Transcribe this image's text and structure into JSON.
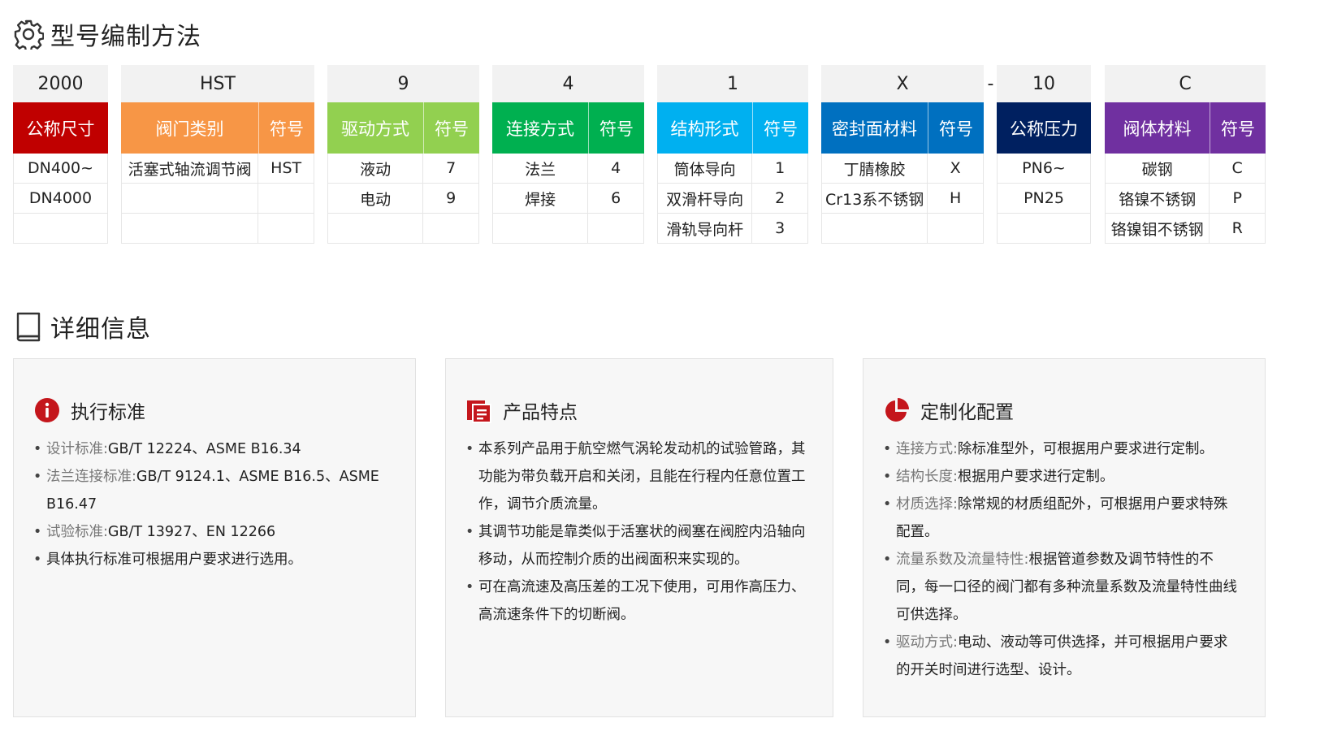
{
  "section1": {
    "title": "型号编制方法",
    "icon": "gear-icon"
  },
  "code_dash": "-",
  "groups": [
    {
      "code": "2000",
      "header": "公称尺寸",
      "header_sym": "",
      "color": "#c00000",
      "rows": [
        {
          "name": "DN400~",
          "sym": ""
        },
        {
          "name": "DN4000",
          "sym": ""
        },
        {
          "name": "",
          "sym": ""
        }
      ]
    },
    {
      "code": "HST",
      "header": "阀门类别",
      "header_sym": "符号",
      "color": "#f79646",
      "rows": [
        {
          "name": "活塞式轴流调节阀",
          "sym": "HST"
        },
        {
          "name": "",
          "sym": ""
        },
        {
          "name": "",
          "sym": ""
        }
      ]
    },
    {
      "code": "9",
      "header": "驱动方式",
      "header_sym": "符号",
      "color": "#92d050",
      "rows": [
        {
          "name": "液动",
          "sym": "7"
        },
        {
          "name": "电动",
          "sym": "9"
        },
        {
          "name": "",
          "sym": ""
        }
      ]
    },
    {
      "code": "4",
      "header": "连接方式",
      "header_sym": "符号",
      "color": "#00b050",
      "rows": [
        {
          "name": "法兰",
          "sym": "4"
        },
        {
          "name": "焊接",
          "sym": "6"
        },
        {
          "name": "",
          "sym": ""
        }
      ]
    },
    {
      "code": "1",
      "header": "结构形式",
      "header_sym": "符号",
      "color": "#00b0f0",
      "rows": [
        {
          "name": "筒体导向",
          "sym": "1"
        },
        {
          "name": "双滑杆导向",
          "sym": "2"
        },
        {
          "name": "滑轨导向杆",
          "sym": "3"
        }
      ]
    },
    {
      "code": "X",
      "header": "密封面材料",
      "header_sym": "符号",
      "color": "#0070c0",
      "rows": [
        {
          "name": "丁腈橡胶",
          "sym": "X"
        },
        {
          "name": "Cr13系不锈钢",
          "sym": "H"
        },
        {
          "name": "",
          "sym": ""
        }
      ]
    },
    {
      "code": "10",
      "header": "公称压力",
      "header_sym": "",
      "color": "#002060",
      "rows": [
        {
          "name": "PN6~",
          "sym": ""
        },
        {
          "name": "PN25",
          "sym": ""
        },
        {
          "name": "",
          "sym": ""
        }
      ]
    },
    {
      "code": "C",
      "header": "阀体材料",
      "header_sym": "符号",
      "color": "#7030a0",
      "rows": [
        {
          "name": "碳钢",
          "sym": "C"
        },
        {
          "name": "铬镍不锈钢",
          "sym": "P"
        },
        {
          "name": "铬镍钼不锈钢",
          "sym": "R"
        }
      ]
    }
  ],
  "section2": {
    "title": "详细信息",
    "icon": "book-icon"
  },
  "cards": [
    {
      "title": "执行标准",
      "icon": "info-icon",
      "items": [
        {
          "key": "设计标准:",
          "text": "GB/T 12224、ASME B16.34"
        },
        {
          "key": "法兰连接标准:",
          "text": "GB/T 9124.1、ASME B16.5、ASME B16.47"
        },
        {
          "key": "试验标准:",
          "text": "GB/T 13927、EN 12266"
        },
        {
          "key": "",
          "text": "具体执行标准可根据用户要求进行选用。"
        }
      ]
    },
    {
      "title": "产品特点",
      "icon": "document-icon",
      "items": [
        {
          "key": "",
          "text": "本系列产品用于航空燃气涡轮发动机的试验管路，其功能为带负载开启和关闭，且能在行程内任意位置工作，调节介质流量。"
        },
        {
          "key": "",
          "text": "其调节功能是靠类似于活塞状的阀塞在阀腔内沿轴向移动，从而控制介质的出阀面积来实现的。"
        },
        {
          "key": "",
          "text": "可在高流速及高压差的工况下使用，可用作高压力、高流速条件下的切断阀。"
        }
      ]
    },
    {
      "title": "定制化配置",
      "icon": "pie-chart-icon",
      "items": [
        {
          "key": "连接方式:",
          "text": "除标准型外，可根据用户要求进行定制。"
        },
        {
          "key": "结构长度:",
          "text": "根据用户要求进行定制。"
        },
        {
          "key": "材质选择:",
          "text": "除常规的材质组配外，可根据用户要求特殊配置。"
        },
        {
          "key": "流量系数及流量特性:",
          "text": "根据管道参数及调节特性的不同，每一口径的阀门都有多种流量系数及流量特性曲线可供选择。"
        },
        {
          "key": "驱动方式:",
          "text": "电动、液动等可供选择，并可根据用户要求的开关时间进行选型、设计。"
        }
      ]
    }
  ]
}
